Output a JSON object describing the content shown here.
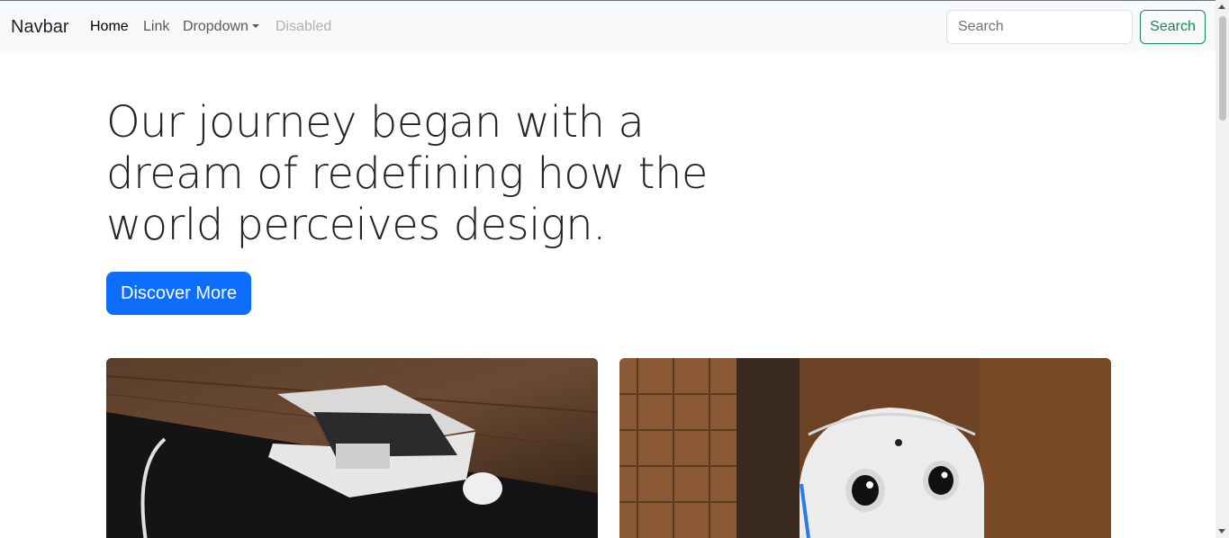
{
  "navbar": {
    "brand": "Navbar",
    "links": [
      {
        "label": "Home",
        "state": "active"
      },
      {
        "label": "Link",
        "state": "normal"
      },
      {
        "label": "Dropdown",
        "state": "normal"
      },
      {
        "label": "Disabled",
        "state": "disabled"
      }
    ],
    "search": {
      "placeholder": "Search",
      "value": ""
    },
    "search_button": "Search"
  },
  "hero": {
    "title": "Our journey began with a dream of redefining how the world perceives design.",
    "cta": "Discover More"
  },
  "cards": [
    {
      "image": "laptop-on-wooden-desk-photo"
    },
    {
      "image": "white-robot-face-photo"
    }
  ],
  "colors": {
    "primary": "#0d6efd",
    "success": "#198754",
    "navbar_bg": "#f8f9fa"
  }
}
